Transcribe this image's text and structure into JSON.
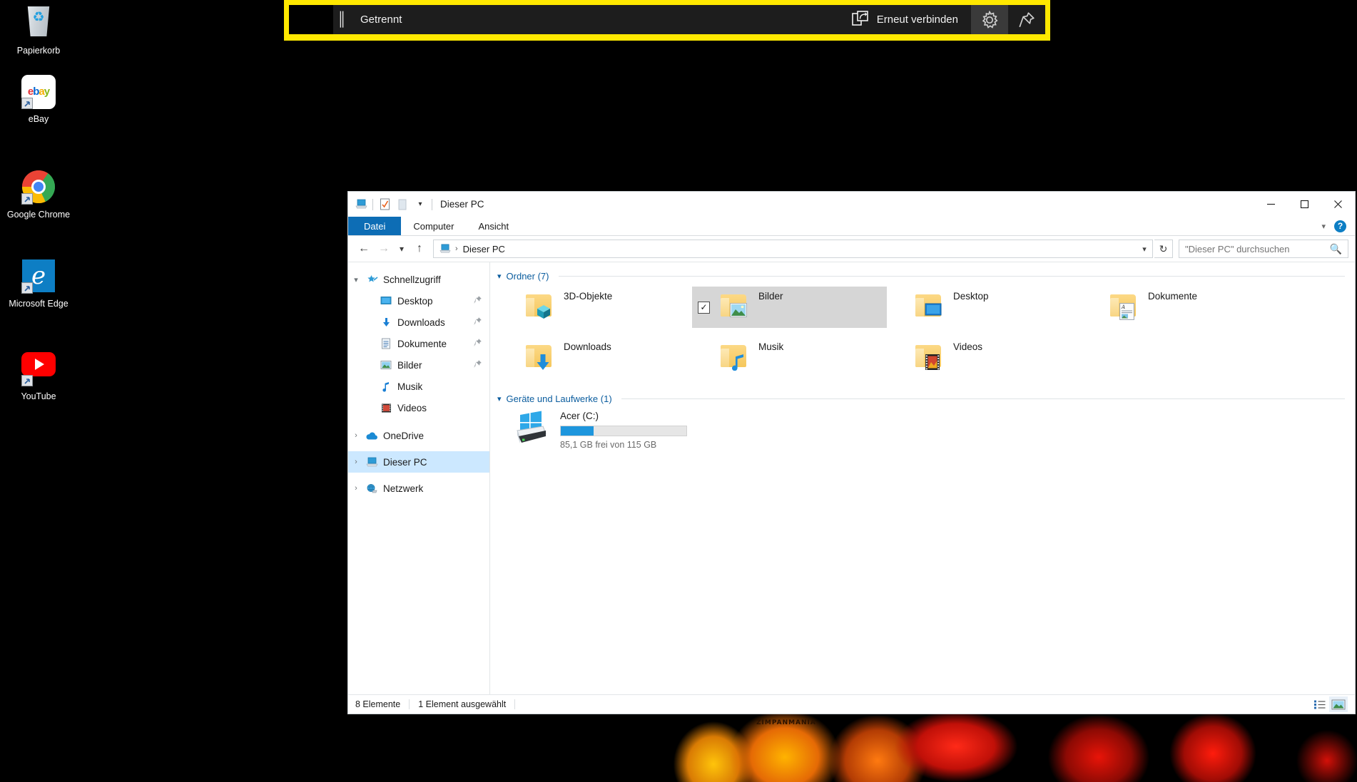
{
  "desktop": {
    "icons": [
      {
        "label": "Papierkorb",
        "icon": "recycle-bin-icon",
        "shortcut": false
      },
      {
        "label": "eBay",
        "icon": "ebay-icon",
        "shortcut": true
      },
      {
        "label": "Google Chrome",
        "icon": "chrome-icon",
        "shortcut": true
      },
      {
        "label": "Microsoft Edge",
        "icon": "edge-icon",
        "shortcut": true
      },
      {
        "label": "YouTube",
        "icon": "youtube-icon",
        "shortcut": true
      }
    ],
    "wallpaper_watermark": "ZIMPANMANIA"
  },
  "connection_bar": {
    "status_label": "Getrennt",
    "reconnect_label": "Erneut verbinden",
    "grip_icon": "drag-grip-icon",
    "reconnect_icon": "reconnect-icon",
    "settings_icon": "gear-icon",
    "pin_icon": "pin-icon",
    "border_color": "#ffe800",
    "background_color": "#1d1d1d"
  },
  "explorer": {
    "title": "Dieser PC",
    "quick_access_toolbar": [
      {
        "icon": "this-pc-icon",
        "name": "this-pc"
      },
      {
        "icon": "properties-icon",
        "name": "properties"
      },
      {
        "icon": "new-folder-icon",
        "name": "new-folder"
      },
      {
        "icon": "chevron-down-icon",
        "name": "customize-qat"
      }
    ],
    "window_controls": {
      "minimize": "—",
      "maximize": "☐",
      "close": "✕"
    },
    "ribbon": {
      "tabs": [
        {
          "label": "Datei",
          "active": true
        },
        {
          "label": "Computer",
          "active": false
        },
        {
          "label": "Ansicht",
          "active": false
        }
      ],
      "expand_icon": "chevron-down-icon",
      "help_label": "?"
    },
    "addressbar": {
      "back_icon": "arrow-left-icon",
      "forward_icon": "arrow-right-icon",
      "recent_icon": "chevron-down-icon",
      "up_icon": "arrow-up-icon",
      "path_icon": "this-pc-icon",
      "path_text": "Dieser PC",
      "dropdown_icon": "chevron-down-icon",
      "refresh_icon": "refresh-icon"
    },
    "search": {
      "placeholder": "\"Dieser PC\" durchsuchen",
      "icon": "search-icon"
    },
    "navpane": {
      "items": [
        {
          "label": "Schnellzugriff",
          "icon": "star-pin-icon",
          "chevron": "˅",
          "level": 0,
          "selected": false,
          "pinned": false
        },
        {
          "label": "Desktop",
          "icon": "desktop-icon",
          "chevron": "",
          "level": 1,
          "selected": false,
          "pinned": true
        },
        {
          "label": "Downloads",
          "icon": "downloads-icon",
          "chevron": "",
          "level": 1,
          "selected": false,
          "pinned": true
        },
        {
          "label": "Dokumente",
          "icon": "documents-icon",
          "chevron": "",
          "level": 1,
          "selected": false,
          "pinned": true
        },
        {
          "label": "Bilder",
          "icon": "pictures-icon",
          "chevron": "",
          "level": 1,
          "selected": false,
          "pinned": true
        },
        {
          "label": "Musik",
          "icon": "music-icon",
          "chevron": "",
          "level": 1,
          "selected": false,
          "pinned": false
        },
        {
          "label": "Videos",
          "icon": "videos-icon",
          "chevron": "",
          "level": 1,
          "selected": false,
          "pinned": false
        },
        {
          "label": "OneDrive",
          "icon": "onedrive-icon",
          "chevron": "›",
          "level": 0,
          "selected": false,
          "pinned": false
        },
        {
          "label": "Dieser PC",
          "icon": "this-pc-icon",
          "chevron": "›",
          "level": 0,
          "selected": true,
          "pinned": false
        },
        {
          "label": "Netzwerk",
          "icon": "network-icon",
          "chevron": "›",
          "level": 0,
          "selected": false,
          "pinned": false
        }
      ]
    },
    "groups": [
      {
        "header": "Ordner (7)",
        "chevron": "˅",
        "items": [
          {
            "label": "3D-Objekte",
            "icon": "folder-3d-objects-icon",
            "selected": false,
            "checked": false
          },
          {
            "label": "Bilder",
            "icon": "folder-pictures-icon",
            "selected": true,
            "checked": true
          },
          {
            "label": "Desktop",
            "icon": "folder-desktop-icon",
            "selected": false,
            "checked": false
          },
          {
            "label": "Dokumente",
            "icon": "folder-documents-icon",
            "selected": false,
            "checked": false
          },
          {
            "label": "Downloads",
            "icon": "folder-downloads-icon",
            "selected": false,
            "checked": false
          },
          {
            "label": "Musik",
            "icon": "folder-music-icon",
            "selected": false,
            "checked": false
          },
          {
            "label": "Videos",
            "icon": "folder-videos-icon",
            "selected": false,
            "checked": false
          }
        ]
      }
    ],
    "drives_group": {
      "header": "Geräte und Laufwerke (1)",
      "chevron": "˅",
      "drives": [
        {
          "label": "Acer (C:)",
          "icon": "windows-drive-icon",
          "free_text": "85,1 GB frei von 115 GB",
          "used_percent": 26,
          "bar_color": "#1e96dd"
        }
      ]
    },
    "statusbar": {
      "item_count": "8 Elemente",
      "selection": "1 Element ausgewählt",
      "details_view_icon": "details-view-icon",
      "large_icons_view_icon": "large-icons-view-icon"
    }
  }
}
